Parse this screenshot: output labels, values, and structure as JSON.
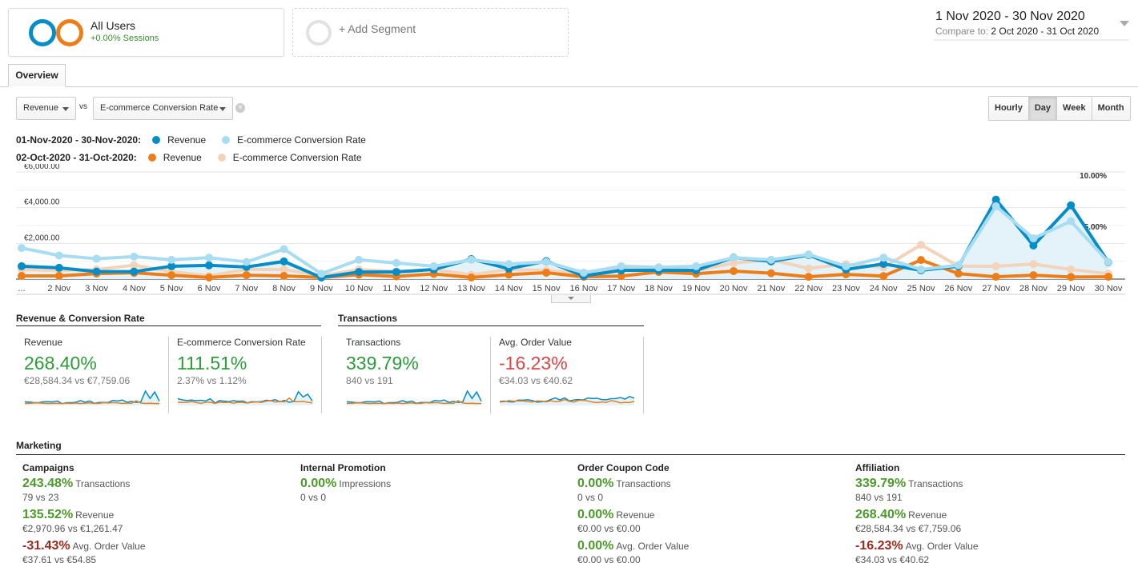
{
  "segments": {
    "all_users": {
      "title": "All Users",
      "subtitle": "+0.00% Sessions"
    },
    "add_segment": {
      "label": "+ Add Segment"
    }
  },
  "date_range": {
    "main": "1 Nov 2020 - 30 Nov 2020",
    "compare_prefix": "Compare to:",
    "compare_value": "2 Oct 2020 - 31 Oct 2020"
  },
  "tabs": [
    {
      "label": "Overview",
      "active": true
    }
  ],
  "metric_selector": {
    "primary": "Revenue",
    "vs_label": "vs",
    "secondary": "E-commerce Conversion Rate",
    "clear_icon": "x-circle-icon"
  },
  "granularity": {
    "options": [
      "Hourly",
      "Day",
      "Week",
      "Month"
    ],
    "active": "Day"
  },
  "legend": [
    {
      "period": "01-Nov-2020 - 30-Nov-2020:",
      "items": [
        {
          "label": "Revenue",
          "color": "#058dc7"
        },
        {
          "label": "E-commerce Conversion Rate",
          "color": "#a8dcf1"
        }
      ]
    },
    {
      "period": "02-Oct-2020 - 31-Oct-2020:",
      "items": [
        {
          "label": "Revenue",
          "color": "#ed7e17"
        },
        {
          "label": "E-commerce Conversion Rate",
          "color": "#f3d4bb"
        }
      ]
    }
  ],
  "chart_data": {
    "type": "line",
    "title": "",
    "x": [
      "...",
      "2 Nov",
      "3 Nov",
      "4 Nov",
      "5 Nov",
      "6 Nov",
      "7 Nov",
      "8 Nov",
      "9 Nov",
      "10 Nov",
      "11 Nov",
      "12 Nov",
      "13 Nov",
      "14 Nov",
      "15 Nov",
      "16 Nov",
      "17 Nov",
      "18 Nov",
      "19 Nov",
      "20 Nov",
      "21 Nov",
      "22 Nov",
      "23 Nov",
      "24 Nov",
      "25 Nov",
      "26 Nov",
      "27 Nov",
      "28 Nov",
      "29 Nov",
      "30 Nov"
    ],
    "y_left": {
      "label": "Revenue",
      "ticks": [
        "€2,000.00",
        "€4,000.00",
        "€6,000.00"
      ],
      "range": [
        0,
        6000
      ]
    },
    "y_right": {
      "label": "E-commerce Conversion Rate",
      "ticks": [
        "5.00%",
        "10.00%"
      ],
      "range": [
        0,
        10
      ]
    },
    "grid": true,
    "series": [
      {
        "name": "Revenue (01-Nov-2020 - 30-Nov-2020)",
        "axis": "left",
        "color": "#058dc7",
        "fill": true,
        "values": [
          720,
          630,
          420,
          420,
          720,
          770,
          680,
          990,
          90,
          400,
          400,
          540,
          1120,
          580,
          1010,
          180,
          490,
          490,
          490,
          1210,
          990,
          1350,
          540,
          850,
          490,
          720,
          4450,
          1880,
          4130,
          940
        ]
      },
      {
        "name": "E-commerce Conversion Rate (01-Nov-2020 - 30-Nov-2020)",
        "axis": "right",
        "color": "#a8dcf1",
        "values": [
          2.9,
          2.2,
          1.9,
          2.1,
          1.8,
          2.0,
          1.6,
          2.8,
          0.5,
          1.8,
          1.5,
          1.2,
          1.8,
          1.4,
          1.6,
          0.6,
          1.2,
          1.1,
          1.2,
          2.0,
          1.8,
          2.3,
          1.2,
          2.0,
          0.9,
          1.3,
          6.8,
          3.8,
          5.4,
          1.6
        ]
      },
      {
        "name": "Revenue (02-Oct-2020 - 31-Oct-2020)",
        "axis": "left",
        "color": "#ed7e17",
        "values": [
          180,
          180,
          310,
          350,
          220,
          90,
          220,
          180,
          90,
          250,
          150,
          290,
          90,
          250,
          360,
          130,
          170,
          400,
          300,
          450,
          330,
          130,
          270,
          170,
          1070,
          310,
          130,
          220,
          120,
          130
        ]
      },
      {
        "name": "E-commerce Conversion Rate (02-Oct-2020 - 31-Oct-2020)",
        "axis": "right",
        "color": "#f3d4bb",
        "values": [
          0.9,
          0.8,
          0.9,
          1.3,
          0.7,
          0.3,
          0.9,
          0.9,
          0.3,
          0.9,
          0.7,
          0.9,
          0.4,
          0.9,
          0.8,
          0.5,
          0.9,
          1.1,
          0.8,
          1.5,
          1.8,
          1.0,
          1.4,
          1.1,
          3.2,
          1.2,
          1.2,
          1.4,
          0.9,
          0.5
        ]
      }
    ]
  },
  "groups": [
    {
      "title": "Revenue & Conversion Rate",
      "cards": [
        {
          "title": "Revenue",
          "value": "268.40%",
          "direction": "positive",
          "compare": "€28,584.34 vs €7,759.06"
        },
        {
          "title": "E-commerce Conversion Rate",
          "value": "111.51%",
          "direction": "positive",
          "compare": "2.37% vs 1.12%"
        }
      ]
    },
    {
      "title": "Transactions",
      "cards": [
        {
          "title": "Transactions",
          "value": "339.79%",
          "direction": "positive",
          "compare": "840 vs 191"
        },
        {
          "title": "Avg. Order Value",
          "value": "-16.23%",
          "direction": "negative",
          "compare": "€34.03 vs €40.62"
        }
      ]
    }
  ],
  "marketing": {
    "title": "Marketing",
    "columns": [
      {
        "title": "Campaigns",
        "items": [
          {
            "pct": "243.48%",
            "metric": "Transactions",
            "compare": "79 vs 23",
            "direction": "positive"
          },
          {
            "pct": "135.52%",
            "metric": "Revenue",
            "compare": "€2,970.96 vs €1,261.47",
            "direction": "positive"
          },
          {
            "pct": "-31.43%",
            "metric": "Avg. Order Value",
            "compare": "€37.61 vs €54.85",
            "direction": "negative"
          }
        ]
      },
      {
        "title": "Internal Promotion",
        "items": [
          {
            "pct": "0.00%",
            "metric": "Impressions",
            "compare": "0 vs 0",
            "direction": "positive"
          }
        ]
      },
      {
        "title": "Order Coupon Code",
        "items": [
          {
            "pct": "0.00%",
            "metric": "Transactions",
            "compare": "0 vs 0",
            "direction": "positive"
          },
          {
            "pct": "0.00%",
            "metric": "Revenue",
            "compare": "€0.00 vs €0.00",
            "direction": "positive"
          },
          {
            "pct": "0.00%",
            "metric": "Avg. Order Value",
            "compare": "€0.00 vs €0.00",
            "direction": "positive"
          }
        ]
      },
      {
        "title": "Affiliation",
        "items": [
          {
            "pct": "339.79%",
            "metric": "Transactions",
            "compare": "840 vs 191",
            "direction": "positive"
          },
          {
            "pct": "268.40%",
            "metric": "Revenue",
            "compare": "€28,584.34 vs €7,759.06",
            "direction": "positive"
          },
          {
            "pct": "-16.23%",
            "metric": "Avg. Order Value",
            "compare": "€34.03 vs €40.62",
            "direction": "negative"
          }
        ]
      }
    ]
  }
}
